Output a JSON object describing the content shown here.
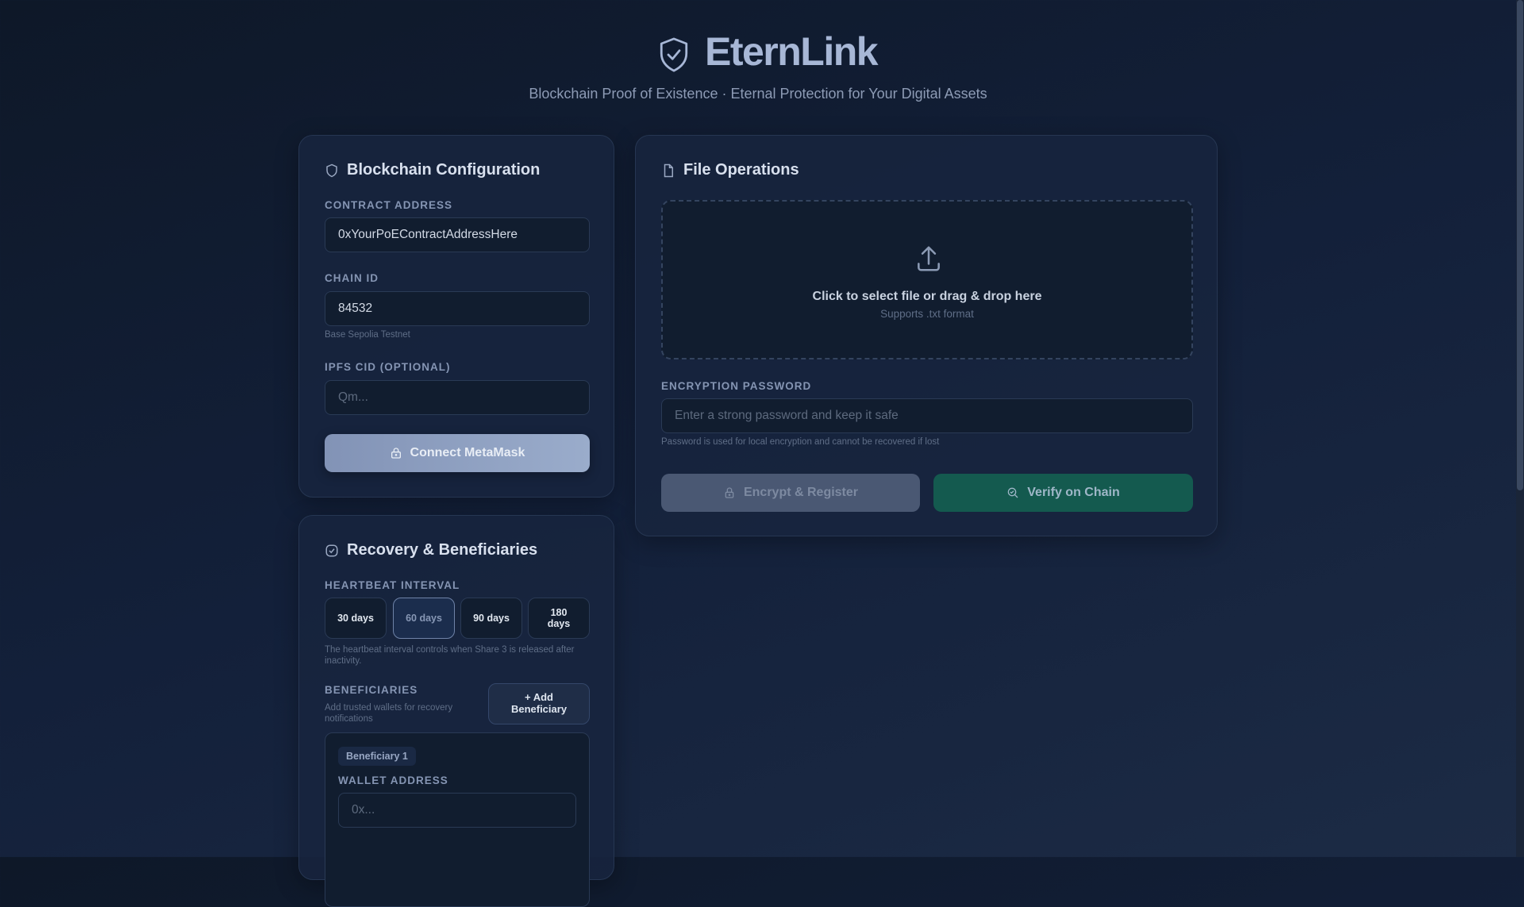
{
  "header": {
    "title": "EternLink",
    "subtitle": "Blockchain Proof of Existence · Eternal Protection for Your Digital Assets",
    "logo_icon": "shield-check-icon"
  },
  "blockchain": {
    "title": "Blockchain Configuration",
    "contract_label": "CONTRACT ADDRESS",
    "contract_value": "0xYourPoEContractAddressHere",
    "chain_label": "CHAIN ID",
    "chain_value": "84532",
    "chain_hint": "Base Sepolia Testnet",
    "ipfs_label": "IPFS CID (OPTIONAL)",
    "ipfs_placeholder": "Qm...",
    "connect_label": "Connect MetaMask"
  },
  "recovery": {
    "title": "Recovery & Beneficiaries",
    "heartbeat_label": "HEARTBEAT INTERVAL",
    "options": [
      "30 days",
      "60 days",
      "90 days",
      "180 days"
    ],
    "selected": "60 days",
    "heartbeat_hint": "The heartbeat interval controls when Share 3 is released after inactivity.",
    "beneficiaries_label": "BENEFICIARIES",
    "beneficiaries_hint": "Add trusted wallets for recovery notifications",
    "add_label": "+ Add Beneficiary",
    "beneficiary": {
      "badge": "Beneficiary 1",
      "wallet_label": "WALLET ADDRESS",
      "wallet_placeholder": "0x..."
    }
  },
  "file": {
    "title": "File Operations",
    "drop_text": "Click to select file or drag & drop here",
    "drop_sub": "Supports .txt format",
    "password_label": "ENCRYPTION PASSWORD",
    "password_placeholder": "Enter a strong password and keep it safe",
    "password_hint": "Password is used for local encryption and cannot be recovered if lost",
    "encrypt_label": "Encrypt & Register",
    "verify_label": "Verify on Chain"
  },
  "colors": {
    "accent": "#8ea0c2",
    "verify": "#145a4f",
    "bg": "#13203a"
  }
}
